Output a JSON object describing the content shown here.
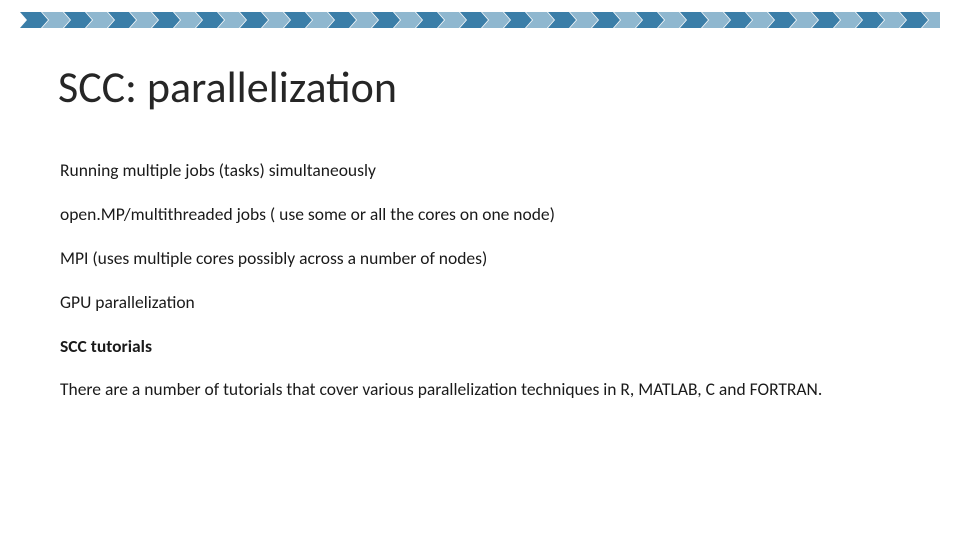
{
  "title": "SCC: parallelization",
  "bullets": {
    "b1": "Running multiple jobs (tasks) simultaneously",
    "b2": "open.MP/multithreaded jobs ( use some or all the cores on one node)",
    "b3": "MPI (uses multiple cores possibly across a number of nodes)",
    "b4": "GPU parallelization"
  },
  "subheading": "SCC tutorials",
  "note": "There are a number of tutorials that cover various parallelization techniques in R, MATLAB, C and FORTRAN."
}
